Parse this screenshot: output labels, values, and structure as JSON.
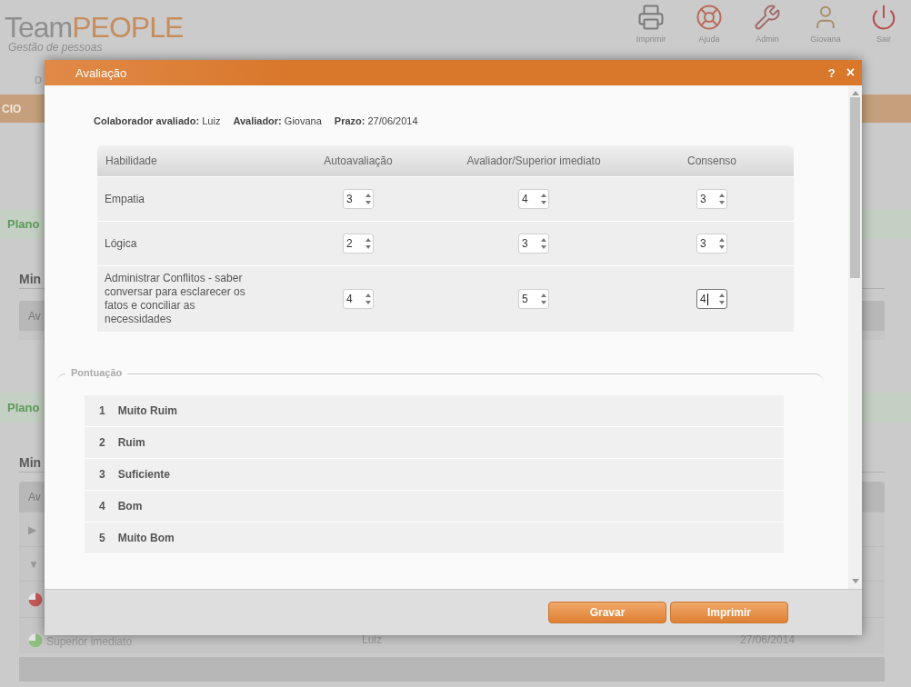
{
  "header": {
    "logo": {
      "part_1": "Team",
      "part_2": "PEOPLE"
    },
    "tagline": "Gestão de pessoas",
    "toolbar": [
      {
        "kind": "printer",
        "label": "Imprimir"
      },
      {
        "kind": "help",
        "label": "Ajuda"
      },
      {
        "kind": "tools",
        "label": "Admin"
      },
      {
        "kind": "user",
        "label": "Giovana"
      },
      {
        "kind": "power",
        "label": "Sair"
      }
    ]
  },
  "background": {
    "nav_tab": "D",
    "menu_bar": "CIO",
    "sections": [
      {
        "banner": "Plano",
        "heading": "Min",
        "table_header": "Av"
      },
      {
        "banner": "Plano",
        "heading": "Min",
        "table_header": "Av",
        "rows": [
          {
            "kind": "collapsed",
            "arrow": "▶"
          },
          {
            "kind": "expanded",
            "arrow": "▼"
          },
          {
            "kind": "pie",
            "color": "#c55a5a"
          },
          {
            "kind": "pie",
            "color": "#8fbf7f",
            "cells": [
              "Superior imediato",
              "Luiz",
              "27/06/2014"
            ]
          }
        ]
      }
    ]
  },
  "dialog": {
    "title": "Avaliação",
    "help": "?",
    "close": "×",
    "info": [
      "**Colaborador avaliado:** Luiz",
      "**Avaliador:** Giovana",
      "**Prazo:** 27/06/2014"
    ],
    "table": {
      "columns": [
        "Habilidade",
        "Autoavaliação",
        "Avaliador/Superior imediato",
        "Consenso"
      ],
      "rows": [
        {
          "skill": "Empatia",
          "scores": [
            {
              "value": "3",
              "focused": false
            },
            {
              "value": "4",
              "focused": false
            },
            {
              "value": "3",
              "focused": false
            }
          ]
        },
        {
          "skill": "Lógica",
          "scores": [
            {
              "value": "2",
              "focused": false
            },
            {
              "value": "3",
              "focused": false
            },
            {
              "value": "3",
              "focused": false
            }
          ]
        },
        {
          "skill": "Administrar Conflitos - saber conversar para esclarecer os fatos e conciliar as necessidades",
          "scores": [
            {
              "value": "4",
              "focused": false
            },
            {
              "value": "5",
              "focused": false
            },
            {
              "value": "4",
              "focused": true
            }
          ]
        }
      ]
    },
    "scale": {
      "legend": "Pontuação",
      "items": [
        {
          "number": "1",
          "label": "Muito Ruim"
        },
        {
          "number": "2",
          "label": "Ruim"
        },
        {
          "number": "3",
          "label": "Suficiente"
        },
        {
          "number": "4",
          "label": "Bom"
        },
        {
          "number": "5",
          "label": "Muito Bom"
        }
      ]
    },
    "buttons": [
      "Gravar",
      "Imprimir"
    ]
  }
}
